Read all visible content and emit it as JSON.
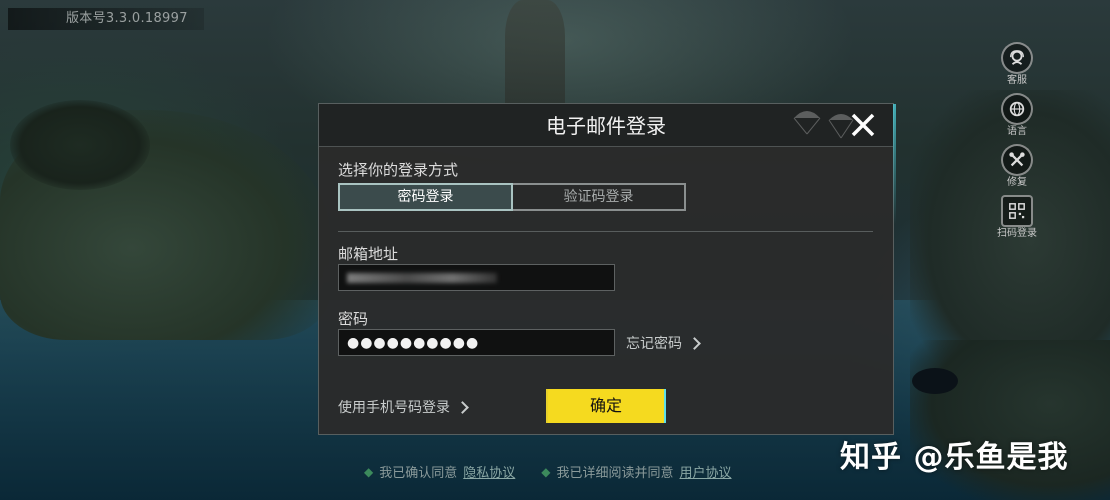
{
  "version_label": "版本号3.3.0.18997",
  "dialog": {
    "title": "电子邮件登录",
    "choose_method_label": "选择你的登录方式",
    "tabs": [
      {
        "label": "密码登录",
        "active": true
      },
      {
        "label": "验证码登录",
        "active": false
      }
    ],
    "email_label": "邮箱地址",
    "email_value_obscured": true,
    "password_label": "密码",
    "password_value": "●●●●●●●●●●",
    "forgot_password": "忘记密码",
    "phone_login": "使用手机号码登录",
    "confirm_button": "确定"
  },
  "side_menu": [
    {
      "label": "客服",
      "icon": "customer-service-icon"
    },
    {
      "label": "语言",
      "icon": "globe-icon"
    },
    {
      "label": "修复",
      "icon": "repair-tools-icon"
    },
    {
      "label": "扫码登录",
      "icon": "qr-code-icon"
    }
  ],
  "agreements": {
    "item1_text": "我已确认同意",
    "item1_link": "隐私协议",
    "item2_text": "我已详细阅读并同意",
    "item2_link": "用户协议"
  },
  "watermark": "知乎 @乐鱼是我",
  "colors": {
    "confirm_yellow": "#f5da1f",
    "active_tab_bg": "#3b4b4c",
    "agree_diamond": "#3c8a5c"
  }
}
